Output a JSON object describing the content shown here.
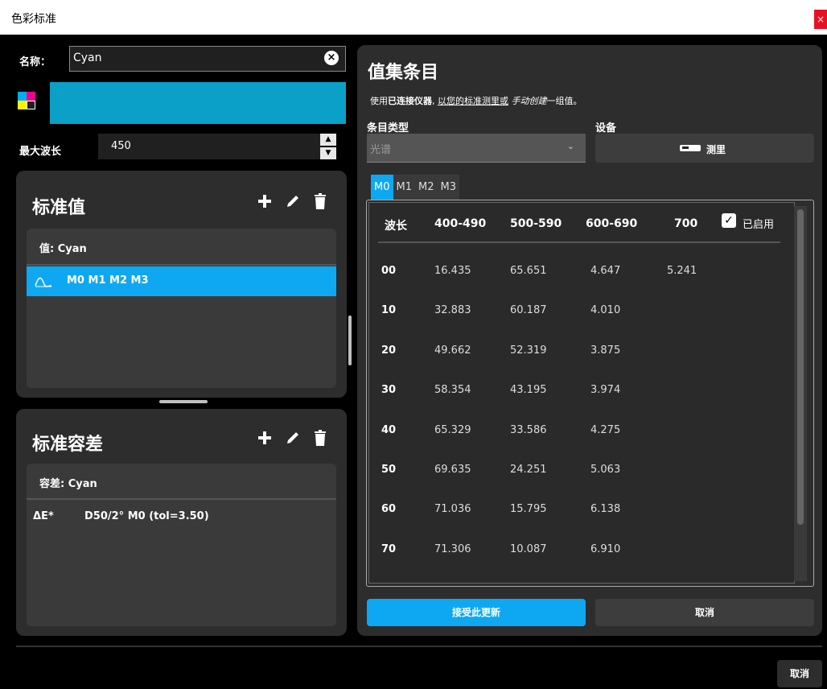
{
  "window": {
    "title": "色彩标准",
    "close_label": "×"
  },
  "name_field": {
    "label": "名称：",
    "value": "Cyan",
    "clear_label": "×"
  },
  "colors": {
    "swatch": "#0aa0c8",
    "accent": "#0ea8f2"
  },
  "max_wavelength": {
    "label": "最大波长",
    "value": "450",
    "up": "▲",
    "down": "▼"
  },
  "standard_values": {
    "title": "标准值",
    "header": "值: Cyan",
    "selected_item": "M0 M1 M2 M3"
  },
  "standard_tolerance": {
    "title": "标准容差",
    "header": "容差: Cyan",
    "item_label": "ΔE*",
    "item_value": "D50/2° M0 (tol=3.50)"
  },
  "right": {
    "title": "值集条目",
    "instruction_prefix": "使用",
    "instruction_bold": "已连接仪器",
    "instruction_mid": ", ",
    "instruction_link": "以您的标准测里或",
    "instruction_italic": " 手动创建",
    "instruction_suffix": "一组值。",
    "entry_type_label": "条目类型",
    "entry_type_value": "光谱",
    "device_label": "设备",
    "measure_button": "测里",
    "tabs": [
      "M0",
      "M1",
      "M2",
      "M3"
    ],
    "enabled_label": "已启用",
    "columns": [
      "波长",
      "400-490",
      "500-590",
      "600-690",
      "700"
    ],
    "rows": [
      {
        "label": "00",
        "values": [
          "16.435",
          "65.651",
          "4.647",
          "5.241"
        ]
      },
      {
        "label": "10",
        "values": [
          "32.883",
          "60.187",
          "4.010",
          ""
        ]
      },
      {
        "label": "20",
        "values": [
          "49.662",
          "52.319",
          "3.875",
          ""
        ]
      },
      {
        "label": "30",
        "values": [
          "58.354",
          "43.195",
          "3.974",
          ""
        ]
      },
      {
        "label": "40",
        "values": [
          "65.329",
          "33.586",
          "4.275",
          ""
        ]
      },
      {
        "label": "50",
        "values": [
          "69.635",
          "24.251",
          "5.063",
          ""
        ]
      },
      {
        "label": "60",
        "values": [
          "71.036",
          "15.795",
          "6.138",
          ""
        ]
      },
      {
        "label": "70",
        "values": [
          "71.306",
          "10.087",
          "6.910",
          ""
        ]
      }
    ],
    "accept_button": "接受此更新",
    "cancel_button": "取消"
  },
  "footer": {
    "cancel_button": "取消"
  }
}
